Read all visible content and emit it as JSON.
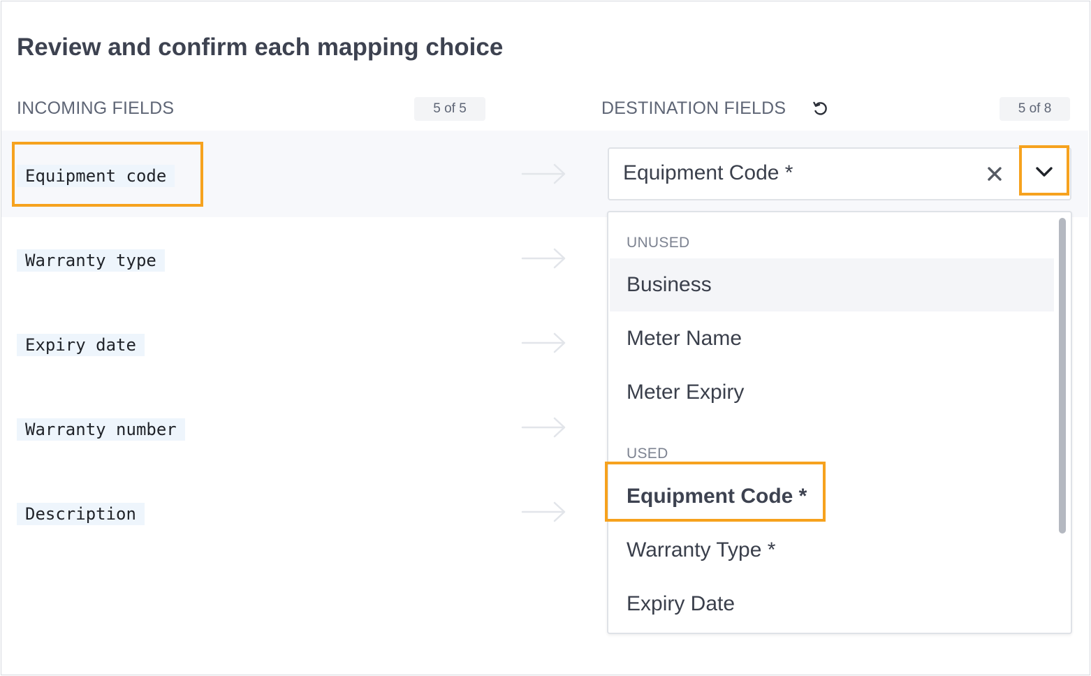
{
  "page": {
    "title": "Review and confirm each mapping choice"
  },
  "incoming": {
    "header": "INCOMING FIELDS",
    "count": "5 of 5",
    "fields": [
      "Equipment code",
      "Warranty type",
      "Expiry date",
      "Warranty number",
      "Description"
    ]
  },
  "destination": {
    "header": "DESTINATION FIELDS",
    "count": "5 of 8",
    "selected_value": "Equipment Code *",
    "dropdown": {
      "unused_label": "UNUSED",
      "unused_options": [
        "Business",
        "Meter Name",
        "Meter Expiry"
      ],
      "used_label": "USED",
      "used_options": [
        "Equipment Code *",
        "Warranty Type *",
        "Expiry Date"
      ]
    }
  },
  "icons": {
    "undo": "undo-icon",
    "clear": "close-icon",
    "expand": "chevron-down-icon",
    "arrow": "arrow-right-icon"
  },
  "colors": {
    "highlight": "#f6a21e",
    "field_bg": "#eef5fc"
  }
}
